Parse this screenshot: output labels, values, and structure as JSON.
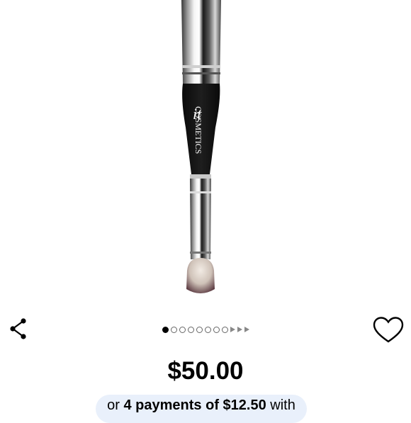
{
  "product": {
    "brand_logo_text": "it COSMETICS",
    "image_icon": "makeup-brush-image"
  },
  "carousel": {
    "total_dots": 9,
    "active_index": 0,
    "next_arrows": 3
  },
  "price": "$50.00",
  "installment": {
    "prefix": "or",
    "payments": "4 payments of",
    "amount": "$12.50",
    "suffix": "with"
  },
  "icons": {
    "share": "share-icon",
    "wishlist": "heart-outline-icon"
  },
  "colors": {
    "installment_bg": "#e9f0fb",
    "active_dot": "#000000"
  }
}
